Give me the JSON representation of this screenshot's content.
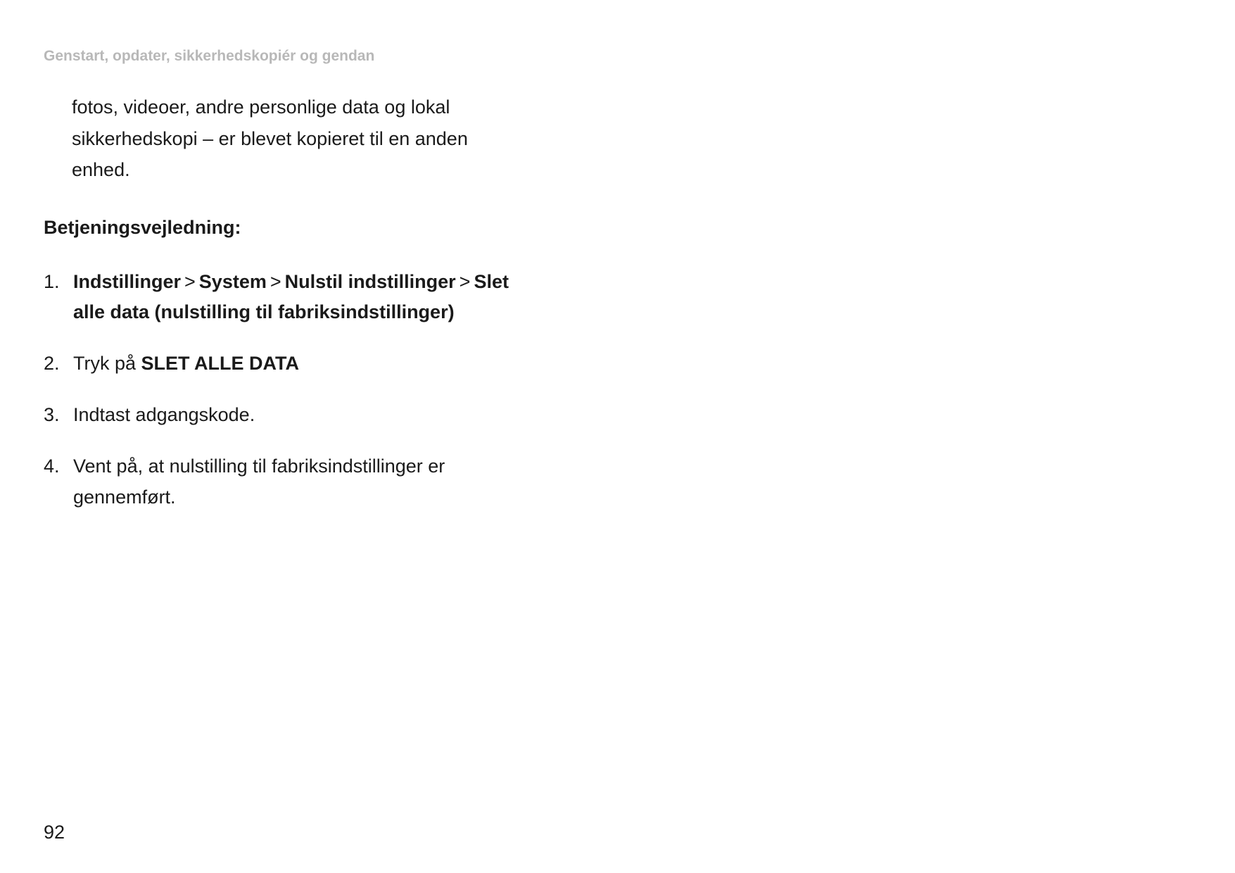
{
  "header": "Genstart, opdater, sikkerhedskopiér og gendan",
  "intro": "fotos, videoer, andre personlige data og lokal sikkerhedskopi – er blevet kopieret til en anden enhed.",
  "sectionHeading": "Betjeningsvejledning:",
  "steps": {
    "step1": {
      "part1": "Indstillinger",
      "sep": ">",
      "part2": "System",
      "part3": "Nulstil indstillinger",
      "part4": "Slet alle data (nulstilling til fabriksindstillinger)"
    },
    "step2": {
      "prefix": "Tryk på ",
      "bold": "SLET ALLE DATA"
    },
    "step3": "Indtast adgangskode.",
    "step4": "Vent på, at nulstilling til fabriksindstillinger er gennemført."
  },
  "pageNumber": "92"
}
